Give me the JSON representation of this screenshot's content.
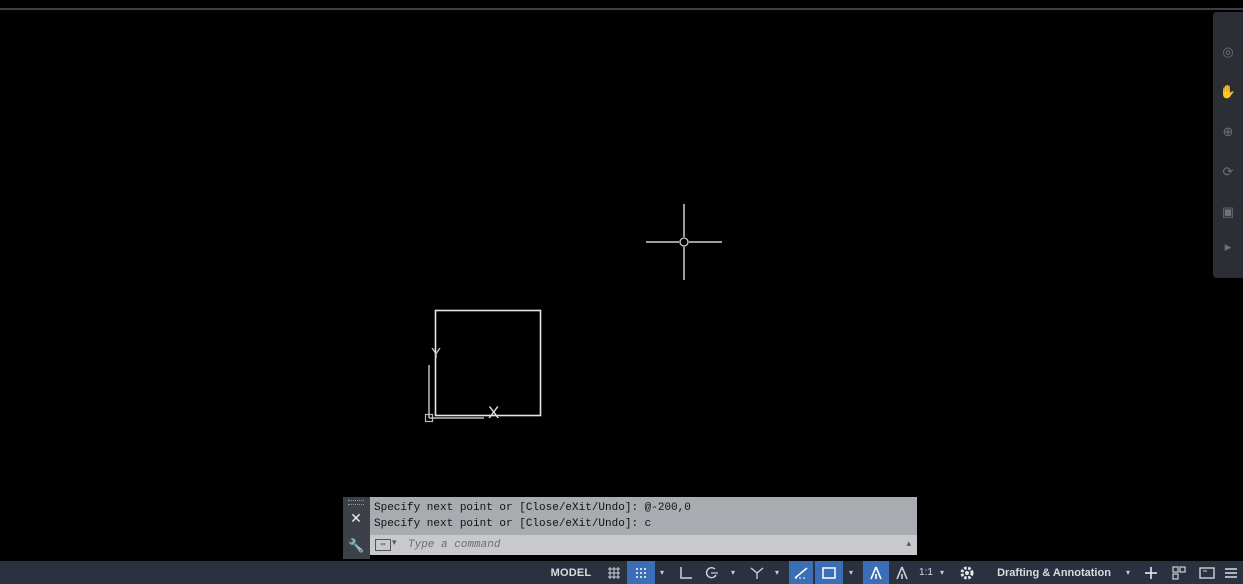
{
  "command_line": {
    "history": [
      "Specify next point or [Close/eXit/Undo]: @-200,0",
      "Specify next point or [Close/eXit/Undo]: c"
    ],
    "input_placeholder": "Type a command",
    "close_icon": "close-icon",
    "customize_icon": "wrench-icon"
  },
  "ucs": {
    "x_label": "X",
    "y_label": "Y"
  },
  "status_bar": {
    "model_label": "MODEL",
    "scale_label": "1:1",
    "workspace_label": "Drafting & Annotation",
    "arrow": "▾",
    "active_color": "#3a6fb8"
  },
  "nav_bar": {
    "icons": [
      "full-navigation-wheel-icon",
      "pan-icon",
      "zoom-icon",
      "orbit-icon",
      "showmotion-icon"
    ]
  }
}
